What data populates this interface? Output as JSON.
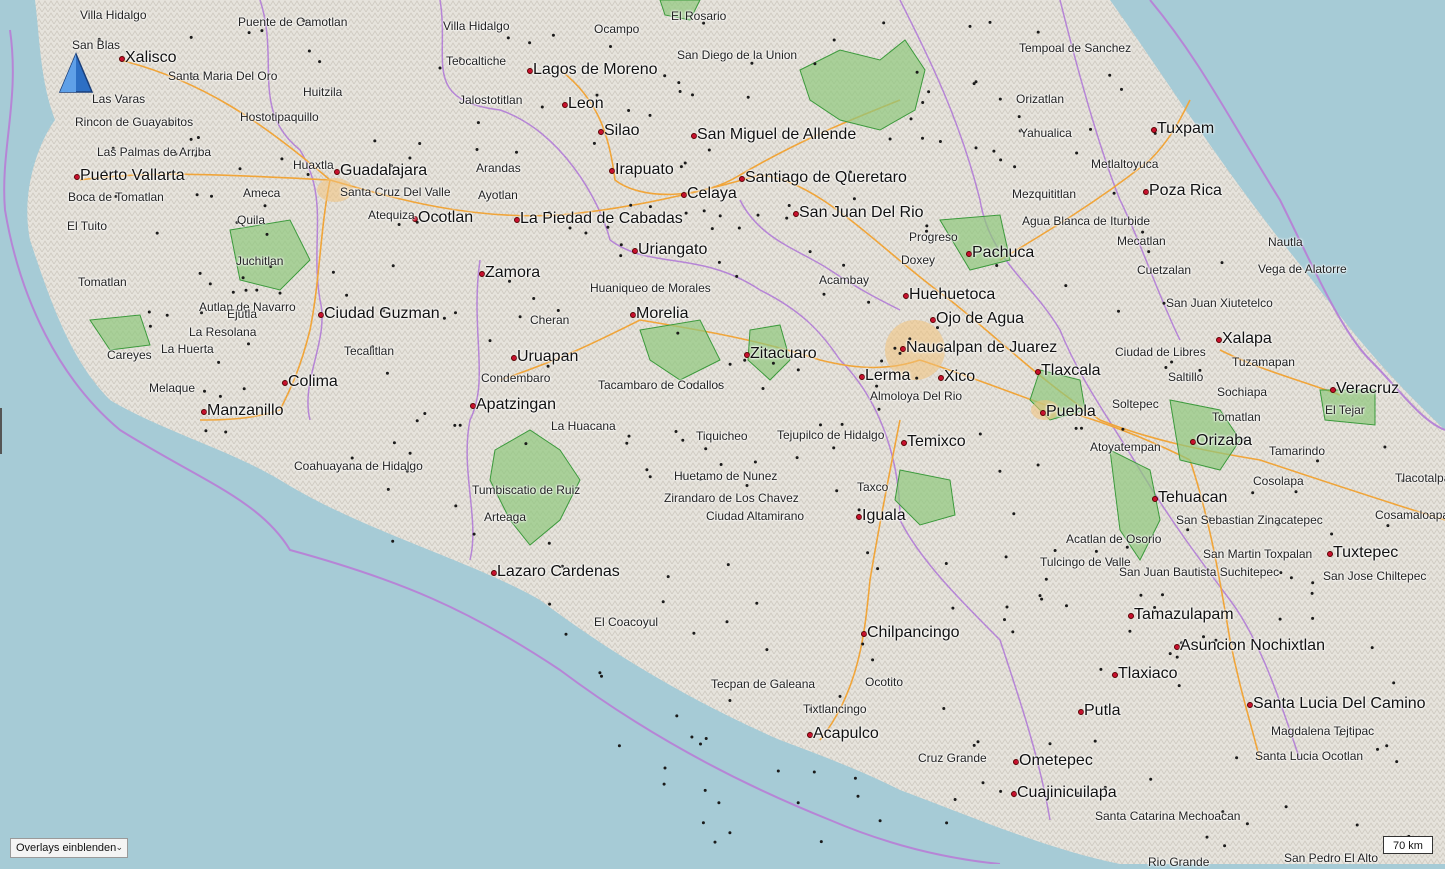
{
  "map": {
    "colors": {
      "water": "#a6cbd6",
      "land": "#e6e3dc",
      "terrain_shade": "#cfcac0",
      "border": "#b685d6",
      "road": "#f0a53a",
      "forest": "#8fc77c",
      "city_dot": "#c8102e"
    },
    "overlays_select": {
      "value": "Overlays einblenden",
      "icon": "chevron-down-icon"
    },
    "scale_label": "70 km",
    "compass_icon": "north-arrow-icon",
    "major_cities": [
      "Xalisco",
      "Lagos de Moreno",
      "Leon",
      "Silao",
      "San Miguel de Allende",
      "Tuxpam",
      "Guadalajara",
      "Puerto Vallarta",
      "Irapuato",
      "Celaya",
      "Santiago de Queretaro",
      "Poza Rica",
      "Ocotlan",
      "La Piedad de Cabadas",
      "San Juan Del Rio",
      "Uriangato",
      "Pachuca",
      "Zamora",
      "Huehuetoca",
      "Ciudad Guzman",
      "Morelia",
      "Ojo de Agua",
      "Naucalpan de Juarez",
      "Xalapa",
      "Uruapan",
      "Zitacuaro",
      "Tlaxcala",
      "Colima",
      "Lerma",
      "Xico",
      "Veracruz",
      "Apatzingan",
      "Puebla",
      "Manzanillo",
      "Temixco",
      "Orizaba",
      "Tehuacan",
      "Iguala",
      "Lazaro Cardenas",
      "Tuxtepec",
      "Tamazulapam",
      "Chilpancingo",
      "Asuncion Nochixtlan",
      "Tlaxiaco",
      "Putla",
      "Santa Lucia Del Camino",
      "Acapulco",
      "Ometepec",
      "Cuajinicuilapa"
    ],
    "minor_places": [
      "Villa Hidalgo",
      "Puente de Camotlan",
      "Villa Hidalgo",
      "El Rosario",
      "Ocampo",
      "San Blas",
      "Tempoal de Sanchez",
      "Teocaltiche",
      "San Diego de la Union",
      "Santa Maria Del Oro",
      "Huitzila",
      "Las Varas",
      "Jalostotitlan",
      "Orizatlan",
      "Hostotipaquillo",
      "Rincon de Guayabitos",
      "Yahualica",
      "Las Palmas de Arriba",
      "Huaxtla",
      "Arandas",
      "Metlaltoyuca",
      "Ameca",
      "Santa Cruz Del Valle",
      "Boca de Tomatlan",
      "Ayotlan",
      "Mezquititlan",
      "Atequiza",
      "Quila",
      "El Tuito",
      "Agua Blanca de Iturbide",
      "Progreso",
      "Mecatlan",
      "Nautla",
      "Juchitlan",
      "Doxey",
      "Cuetzalan",
      "Vega de Alatorre",
      "Tomatlan",
      "Acambay",
      "Huaniqueo de Morales",
      "Autlan de Navarro",
      "Ejutla",
      "San Juan Xiutetelco",
      "Cheran",
      "La Resolana",
      "Careyes",
      "La Huerta",
      "Tecalitlan",
      "Ciudad de Libres",
      "Tuzamapan",
      "Condembaro",
      "Saltillo",
      "Melaque",
      "Tacambaro de Codallos",
      "Almoloya Del Rio",
      "Sochiapa",
      "Soltepec",
      "El Tejar",
      "Tomatlan",
      "La Huacana",
      "Tiquicheo",
      "Tejupilco de Hidalgo",
      "Atoyatempan",
      "Tamarindo",
      "Coahuayana de Hidalgo",
      "Huetamo de Nunez",
      "Tlacotalpan",
      "Cosolapa",
      "Tumbiscatio de Ruiz",
      "Taxco",
      "Zirandaro de Los Chavez",
      "Cosamaloapan",
      "Ciudad Altamirano",
      "San Sebastian Zinacatepec",
      "Arteaga",
      "Acatlan de Osorio",
      "San Martin Toxpalan",
      "Tulcingo de Valle",
      "San Juan Bautista Suchitepec",
      "San Jose Chiltepec",
      "El Coacoyul",
      "Tecpan de Galeana",
      "Ocotito",
      "Tixtlancingo",
      "Magdalena Tejtipac",
      "Santa Lucia Ocotlan",
      "Cruz Grande",
      "Santa Catarina Mechoacan",
      "Rio Grande",
      "San Pedro El Alto"
    ]
  }
}
